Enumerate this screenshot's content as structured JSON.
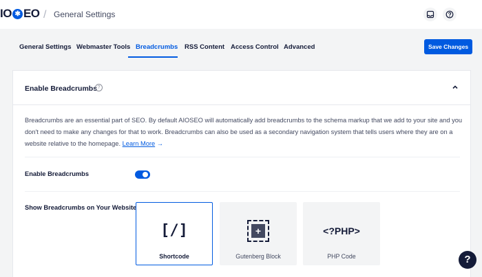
{
  "header": {
    "logo_prefix": "IO",
    "logo_suffix": "EO",
    "page_title": "General Settings"
  },
  "tabs": [
    {
      "label": "General Settings"
    },
    {
      "label": "Webmaster Tools"
    },
    {
      "label": "Breadcrumbs"
    },
    {
      "label": "RSS Content"
    },
    {
      "label": "Access Control"
    },
    {
      "label": "Advanced"
    }
  ],
  "save_label": "Save Changes",
  "card": {
    "title": "Enable Breadcrumbs",
    "info_glyph": "?",
    "description": "Breadcrumbs are an essential part of SEO. By default AIOSEO will automatically add breadcrumbs to the schema markup that we add to your site and you don't need to make any changes for that to work. Breadcrumbs can also be used as a secondary navigation system that tells users where they are on a website relative to the homepage.",
    "learn_more": "Learn More",
    "learn_more_arrow": "→",
    "enable_label": "Enable Breadcrumbs",
    "enable_state": "on",
    "show_label": "Show Breadcrumbs on Your Website",
    "options": [
      {
        "label": "Shortcode",
        "glyph": "[/]",
        "selected": true
      },
      {
        "label": "Gutenberg Block",
        "glyph": "+",
        "selected": false
      },
      {
        "label": "PHP Code",
        "glyph": "<?PHP>",
        "selected": false
      }
    ]
  },
  "help_glyph": "?",
  "icons": {
    "inbox": "inbox-icon",
    "help": "help-icon",
    "collapse": "chevron-up-icon"
  },
  "colors": {
    "accent": "#005ae0",
    "text": "#141b38"
  }
}
